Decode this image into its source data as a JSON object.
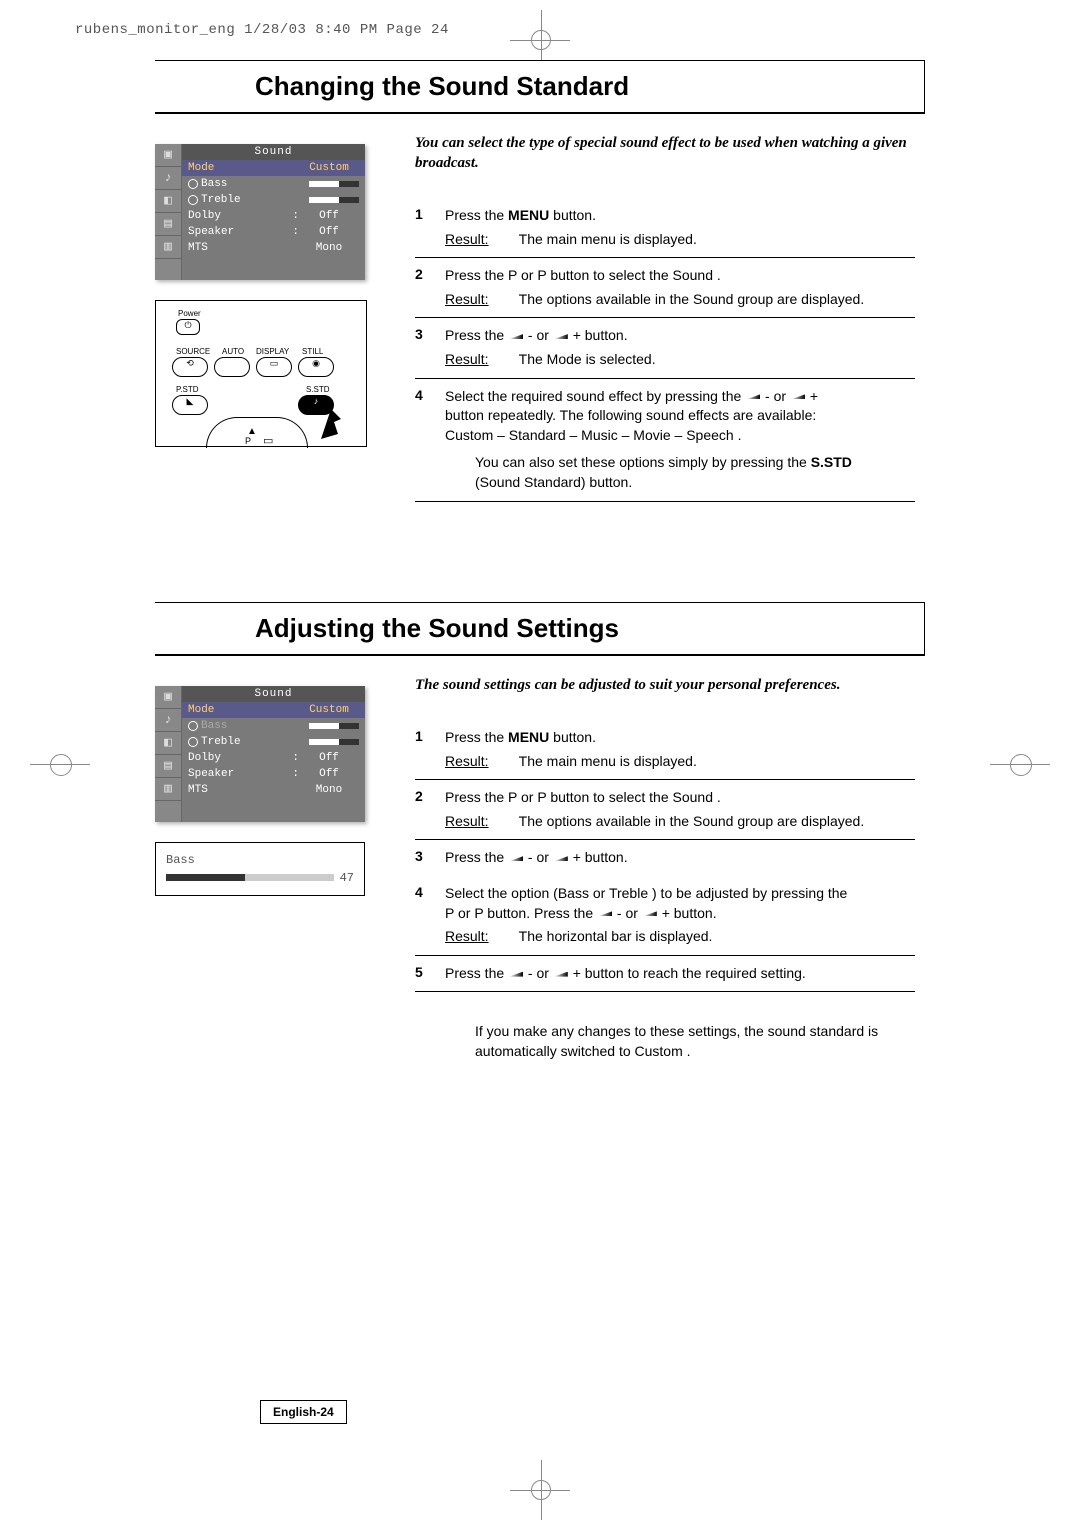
{
  "header_stamp": "rubens_monitor_eng  1/28/03 8:40 PM  Page 24",
  "footer_page": "English-24",
  "section1": {
    "title": "Changing the Sound Standard",
    "intro": "You can select the type of special sound effect to be used when watching a given broadcast.",
    "steps": [
      {
        "n": "1",
        "text_a": "Press the ",
        "bold_a": "MENU",
        "text_b": " button.",
        "result": "The main menu is displayed."
      },
      {
        "n": "2",
        "text_full": "Press the P    or P    button to select the Sound .",
        "result": "The options available in the Sound group are displayed."
      },
      {
        "n": "3",
        "text_full": "Press the          - or          + button.",
        "result": "The Mode is selected."
      },
      {
        "n": "4",
        "line1": "Select the required sound effect by pressing the          - or          +",
        "line2": "button repeatedly. The following sound effects are available:",
        "line3": "Custom  – Standard   – Music  – Movie  – Speech .",
        "note1": "You can also set these options simply by pressing the ",
        "note1_bold": "S.STD",
        "note2": "(Sound Standard) button."
      }
    ]
  },
  "section2": {
    "title": "Adjusting the Sound Settings",
    "intro": "The sound settings can be adjusted to suit your personal preferences.",
    "steps": [
      {
        "n": "1",
        "text_a": "Press the ",
        "bold_a": "MENU",
        "text_b": " button.",
        "result": "The main menu is displayed."
      },
      {
        "n": "2",
        "text_full": "Press the P    or P    button to select the Sound .",
        "result": "The options available in the Sound  group are displayed."
      },
      {
        "n": "3",
        "text_full": "Press the          - or          + button."
      },
      {
        "n": "4",
        "line1": "Select the option (Bass  or Treble   ) to be adjusted by pressing the",
        "line2": "P    or P    button. Press the          - or          + button.",
        "result": "The horizontal bar is displayed."
      },
      {
        "n": "5",
        "text_full": "Press the          - or          + button to reach the required setting."
      }
    ],
    "note_final": "If you make any changes to these settings, the sound standard is automatically switched to Custom ."
  },
  "osd1": {
    "title": "Sound",
    "rows": [
      {
        "lbl": "Mode",
        "val": "Custom",
        "hl": true
      },
      {
        "lbl": "Bass",
        "bar": true,
        "knob": true
      },
      {
        "lbl": "Treble",
        "bar": true,
        "knob": true
      },
      {
        "lbl": "Dolby",
        "sep": ":",
        "val": "Off"
      },
      {
        "lbl": "Speaker",
        "sep": ":",
        "val": "Off"
      },
      {
        "lbl": "MTS",
        "val": "Mono"
      }
    ]
  },
  "osd2": {
    "title": "Sound",
    "rows": [
      {
        "lbl": "Mode",
        "val": "Custom",
        "hl": true
      },
      {
        "lbl": "Bass",
        "bar": true,
        "knob": true,
        "dim": true
      },
      {
        "lbl": "Treble",
        "bar": true,
        "knob": true
      },
      {
        "lbl": "Dolby",
        "sep": ":",
        "val": "Off"
      },
      {
        "lbl": "Speaker",
        "sep": ":",
        "val": "Off"
      },
      {
        "lbl": "MTS",
        "val": "Mono"
      }
    ]
  },
  "bass_panel": {
    "label": "Bass",
    "value": "47"
  },
  "remote": {
    "power": "Power",
    "source": "SOURCE",
    "auto": "AUTO",
    "display": "DISPLAY",
    "still": "STILL",
    "pstd": "P.STD",
    "sstd": "S.STD"
  }
}
